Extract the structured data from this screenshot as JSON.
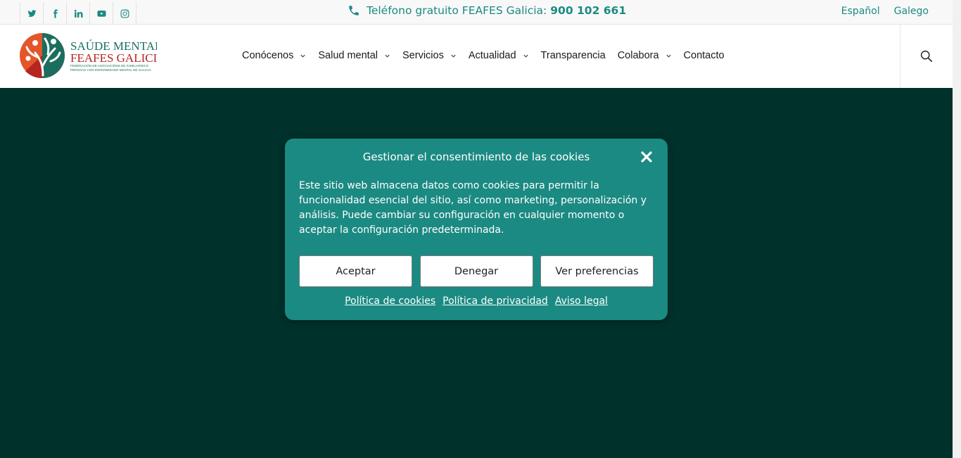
{
  "topbar": {
    "social_icons": [
      "twitter-icon",
      "facebook-icon",
      "linkedin-icon",
      "youtube-icon",
      "instagram-icon"
    ],
    "phone_label": "Teléfono gratuito FEAFES Galicia:",
    "phone_number": "900 102 661",
    "languages": [
      "Español",
      "Galego"
    ]
  },
  "header": {
    "logo": {
      "line1": "SAÚDE MENTAL",
      "line2": "FEAFES GALICIA",
      "tagline1": "FEDERACIÓN DE ASOCIACIÓNS DE FAMILIARES E",
      "tagline2": "PERSOAS CON ENFERMIDADE MENTAL DE GALICIA"
    },
    "nav": [
      {
        "label": "Conócenos",
        "has_dropdown": true
      },
      {
        "label": "Salud mental",
        "has_dropdown": true
      },
      {
        "label": "Servicios",
        "has_dropdown": true
      },
      {
        "label": "Actualidad",
        "has_dropdown": true
      },
      {
        "label": "Transparencia",
        "has_dropdown": false
      },
      {
        "label": "Colabora",
        "has_dropdown": true
      },
      {
        "label": "Contacto",
        "has_dropdown": false
      }
    ]
  },
  "cookie_modal": {
    "title": "Gestionar el consentimiento de las cookies",
    "text": "Este sitio web almacena datos como cookies para permitir la funcionalidad esencial del sitio, así como marketing, personalización y análisis. Puede cambiar su configuración en cualquier momento o aceptar la configuración predeterminada.",
    "buttons": {
      "accept": "Aceptar",
      "deny": "Denegar",
      "preferences": "Ver preferencias"
    },
    "links": {
      "cookies": "Política de cookies",
      "privacy": "Política de privacidad",
      "legal": "Aviso legal"
    }
  },
  "colors": {
    "accent": "#1b8a82",
    "hero_bg": "#01312b",
    "logo_orange": "#e3562a",
    "logo_teal": "#1b6e5e",
    "logo_red": "#b5261e"
  }
}
